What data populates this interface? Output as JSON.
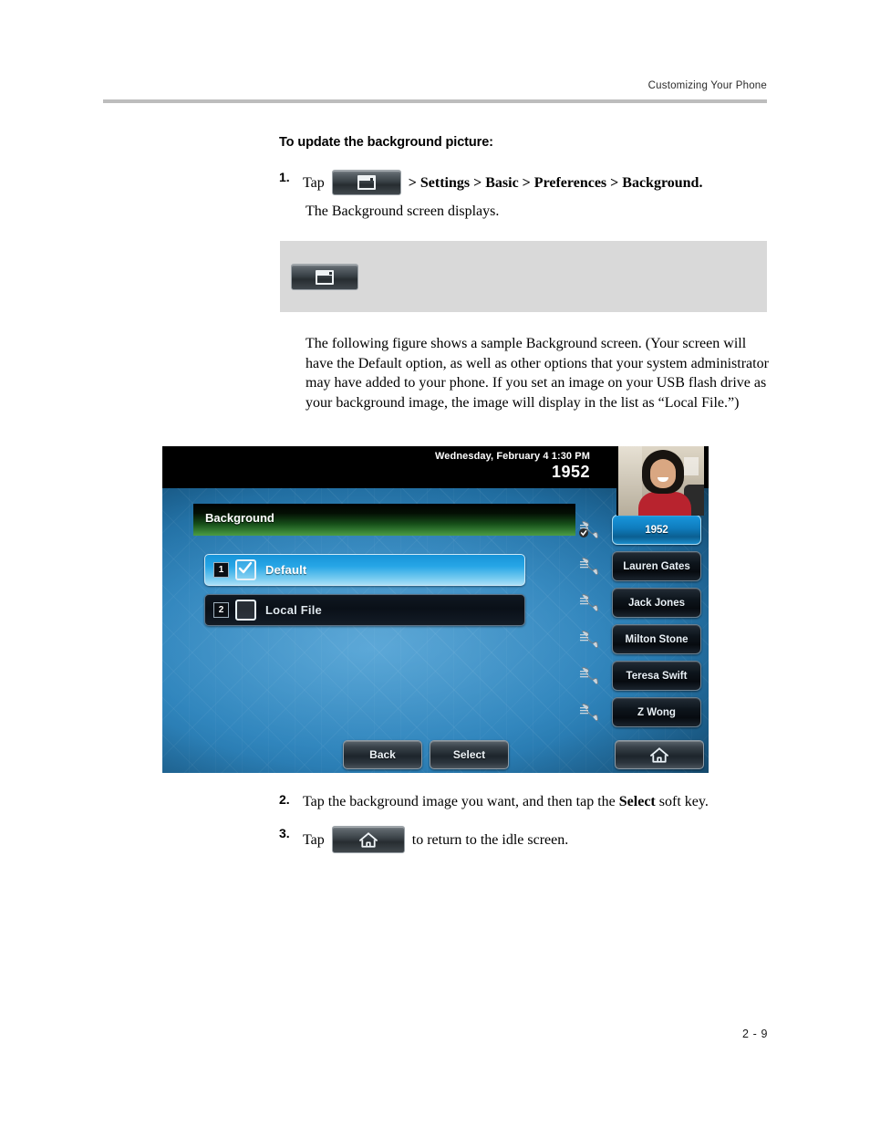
{
  "page": {
    "running_header": "Customizing Your Phone",
    "footer_page_number": "2 - 9"
  },
  "section": {
    "heading": "To update the background picture:",
    "steps": [
      {
        "number": "1.",
        "text_before": "Tap",
        "icon": "menu-window-icon",
        "text_after": "> Settings > Basic > Preferences > Background.",
        "sub_line": "The Background screen displays."
      },
      {
        "number": "2.",
        "text": "Tap the background image you want, and then tap the Select soft key."
      },
      {
        "number": "3.",
        "text_before": "Tap",
        "icon": "home-icon",
        "text_after": "to return to the idle screen."
      }
    ],
    "paragraph": "The following figure shows a sample Background screen. (Your screen will have the Default option, as well as other options that your system administrator may have added to your phone. If you set an image on your USB flash drive as your background image, the image will display in the list as “Local File.”)"
  },
  "callout": {
    "icon": "menu-window-icon"
  },
  "phone_screen": {
    "status_bar": {
      "date_time": "Wednesday, February 4  1:30 PM",
      "extension": "1952",
      "avatar": "user-photo"
    },
    "title_bar": {
      "title": "Background"
    },
    "background_list": [
      {
        "index": "1",
        "label": "Default",
        "checked": true
      },
      {
        "index": "2",
        "label": "Local File",
        "checked": false
      }
    ],
    "line_keys": [
      {
        "label": "1952",
        "active": true,
        "icon": "handset-registered-icon"
      },
      {
        "label": "Lauren Gates",
        "active": false,
        "icon": "handset-icon"
      },
      {
        "label": "Jack Jones",
        "active": false,
        "icon": "handset-icon"
      },
      {
        "label": "Milton Stone",
        "active": false,
        "icon": "handset-icon"
      },
      {
        "label": "Teresa Swift",
        "active": false,
        "icon": "handset-icon"
      },
      {
        "label": "Z Wong",
        "active": false,
        "icon": "handset-icon"
      }
    ],
    "soft_keys": [
      {
        "label": "Back"
      },
      {
        "label": "Select"
      }
    ],
    "home_key": {
      "icon": "home-icon"
    }
  },
  "colors": {
    "header_rule": "#bdbdbd",
    "callout_bg": "#d9d9d9",
    "title_bar_green": "#4c9a45",
    "selected_row_blue": "#27a6e6",
    "active_line_key_blue": "#0f7cbd"
  }
}
